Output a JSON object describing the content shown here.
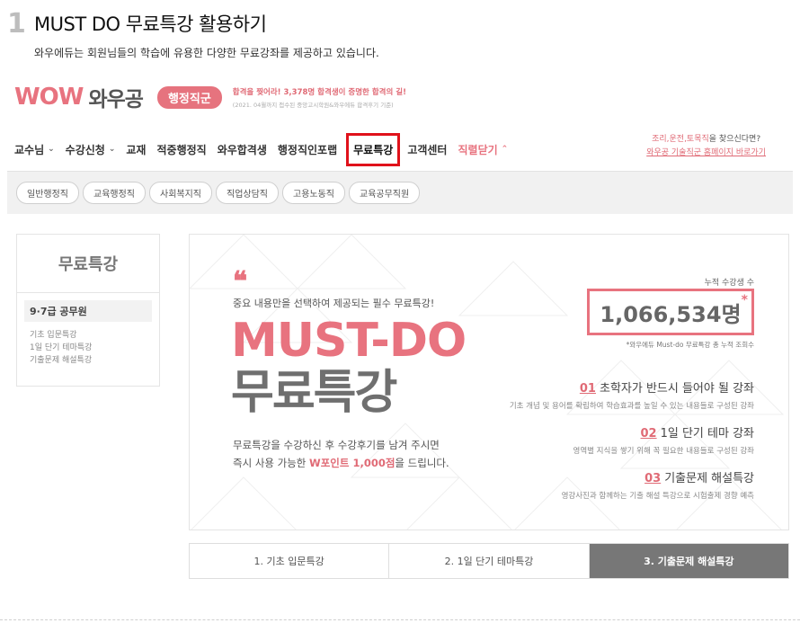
{
  "step": {
    "number": "1",
    "title": "MUST DO 무료특강 활용하기",
    "desc": "와우에듀는 회원님들의 학습에 유용한 다양한 무료강좌를 제공하고 있습니다."
  },
  "logo": {
    "wow": "WOW",
    "kr": "와우공",
    "badge": "행정직군",
    "copy_main": "합격을 찢어라! 3,378명 합격생이 증명한 합격의 길!",
    "copy_sub": "(2021. 04월까지 접수된 중앙고시학원&와우에듀 합격후기 기준)"
  },
  "gnb": {
    "items": [
      {
        "label": "교수님",
        "chevron": "⌄"
      },
      {
        "label": "수강신청",
        "chevron": "⌄"
      },
      {
        "label": "교재",
        "chevron": ""
      },
      {
        "label": "적중행정직",
        "chevron": ""
      },
      {
        "label": "와우합격생",
        "chevron": ""
      },
      {
        "label": "행정직인포랩",
        "chevron": ""
      },
      {
        "label": "무료특강",
        "chevron": ""
      },
      {
        "label": "고객센터",
        "chevron": ""
      },
      {
        "label": "직렬닫기",
        "chevron": "⌃"
      }
    ],
    "right_line1_prefix": "조리,운전,토목직",
    "right_line1_suffix": "을 찾으신다면?",
    "right_line2": "와우공 기술직군 홈페이지 바로가기"
  },
  "subcats": [
    "일반행정직",
    "교육행정직",
    "사회복지직",
    "직업상담직",
    "고용노동직",
    "교육공무직원"
  ],
  "sidebar": {
    "title": "무료특강",
    "group": "9·7급 공무원",
    "links": [
      "기초 입문특강",
      "1일 단기 테마특강",
      "기출문제 해설특강"
    ]
  },
  "hero": {
    "quote": "❝",
    "lead": "중요 내용만을 선택하여 제공되는 필수 무료특강!",
    "big1": "MUST-DO",
    "big2": "무료특강",
    "promo_line1": "무료특강을 수강하신 후 수강후기를 남겨 주시면",
    "promo_line2_pre": "즉시 사용 가능한 ",
    "promo_line2_point": "W포인트 1,000점",
    "promo_line2_post": "을 드립니다.",
    "cum_label": "누적 수강생 수",
    "cum_value": "1,066,534명",
    "cum_star": "*",
    "cum_note": "*와우에듀 Must-do 무료특강 총 누적 조회수",
    "features": [
      {
        "num": "01",
        "title": "초학자가 반드시 들어야 될 강좌",
        "desc": "기초 개념 및 용어를 확립하여 학습효과를 높일 수 있는 내용들로 구성된 강좌"
      },
      {
        "num": "02",
        "title": "1일 단기 테마 강좌",
        "desc": "영역별 지식을 쌓기 위해 꼭 필요한 내용들로 구성된 강좌"
      },
      {
        "num": "03",
        "title": "기출문제 해설특강",
        "desc": "영강사진과 함께하는 기출 해설 특강으로 시험출제 경향 예측"
      }
    ]
  },
  "tabs": [
    "1. 기초 입문특강",
    "2. 1일 단기 테마특강",
    "3. 기출문제 해설특강"
  ],
  "colors": {
    "accent_pink": "#e8737f",
    "highlight_red": "#e0121b",
    "active_tab": "#777777"
  }
}
